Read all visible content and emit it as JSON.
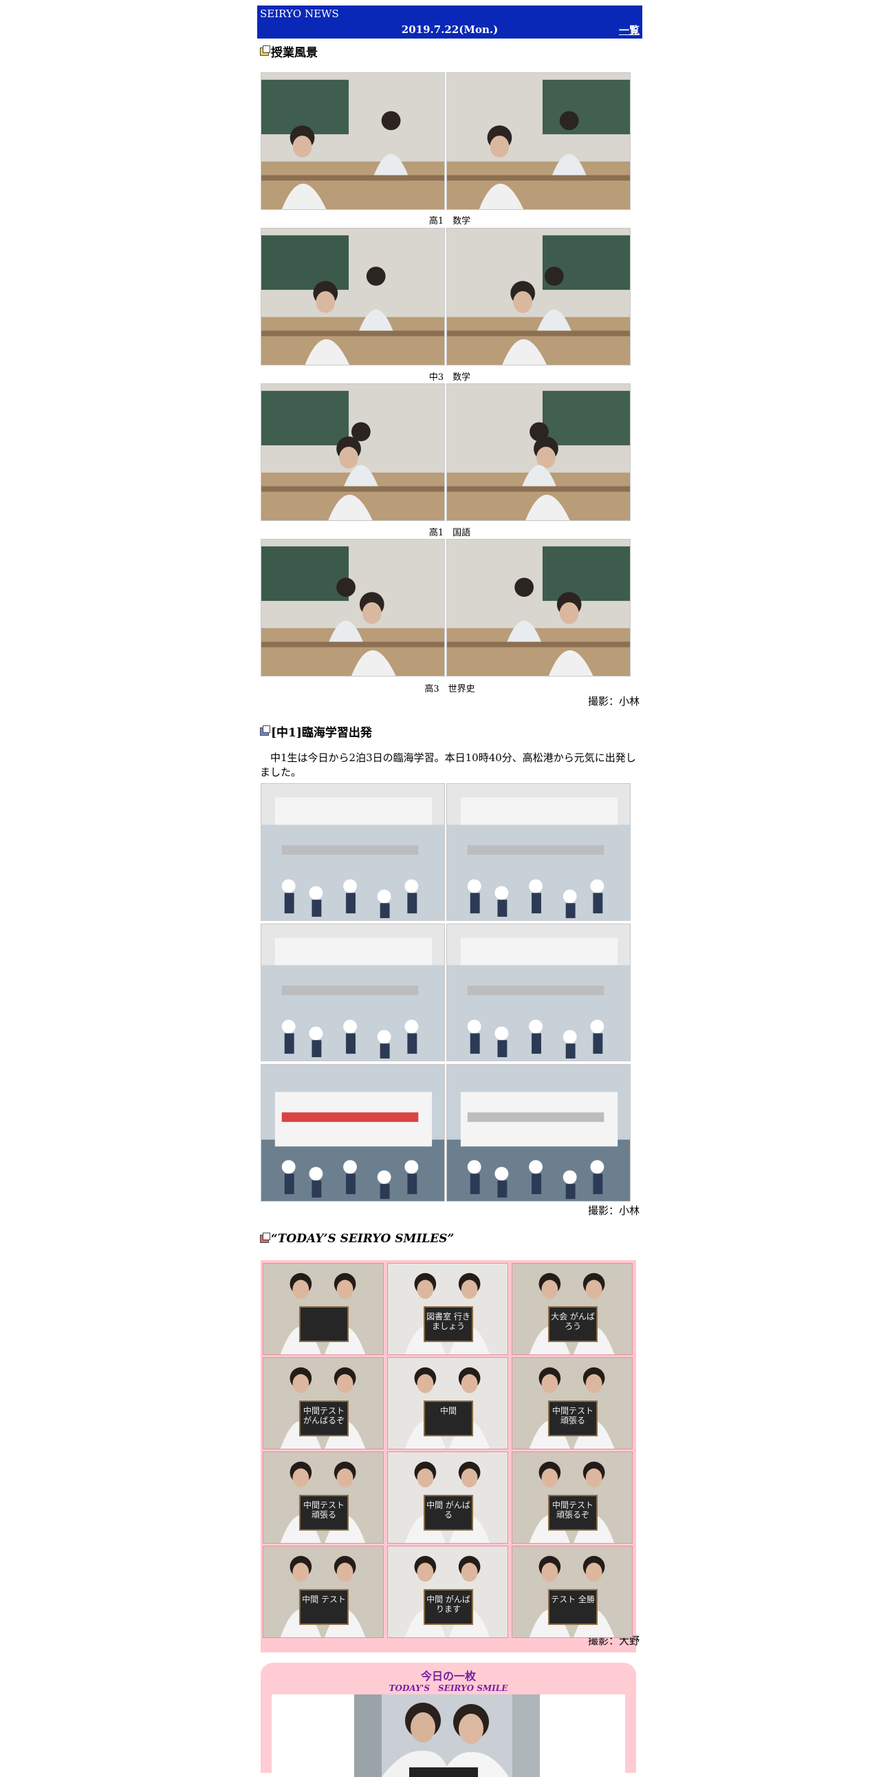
{
  "header": {
    "brand": "SEIRYO NEWS",
    "date": "2019.7.22(Mon.)",
    "list_link": "一覧",
    "bg_color": "#0a28b8"
  },
  "section1": {
    "title": "授業風景",
    "captions": [
      "高1　数学",
      "中3　数学",
      "高1　国語",
      "高3　世界史"
    ],
    "credit": "撮影：小林"
  },
  "section2": {
    "title": "[中1]臨海学習出発",
    "body": "中1生は今日から2泊3日の臨海学習。本日10時40分、高松港から元気に出発しました。",
    "credit": "撮影：小林"
  },
  "section3": {
    "title": "“TODAY’S SEIRYO SMILES”",
    "boards": [
      "",
      "図書室 行きましょう",
      "大会 がんばろう",
      "中間テスト がんばるぞ",
      "中間",
      "中間テスト 頑張る",
      "中間テスト頑張る",
      "中間 がんばる",
      "中間テスト 頑張るぞ",
      "中間 テスト",
      "中間 がんばります",
      "テスト 全勝"
    ],
    "credit": "撮影：大野",
    "accent": "#ffc8d0"
  },
  "section4": {
    "title": "今日の一枚",
    "subtitle": "TODAY'S　SEIRYO SMILE",
    "title_color": "#7a1fa3"
  }
}
